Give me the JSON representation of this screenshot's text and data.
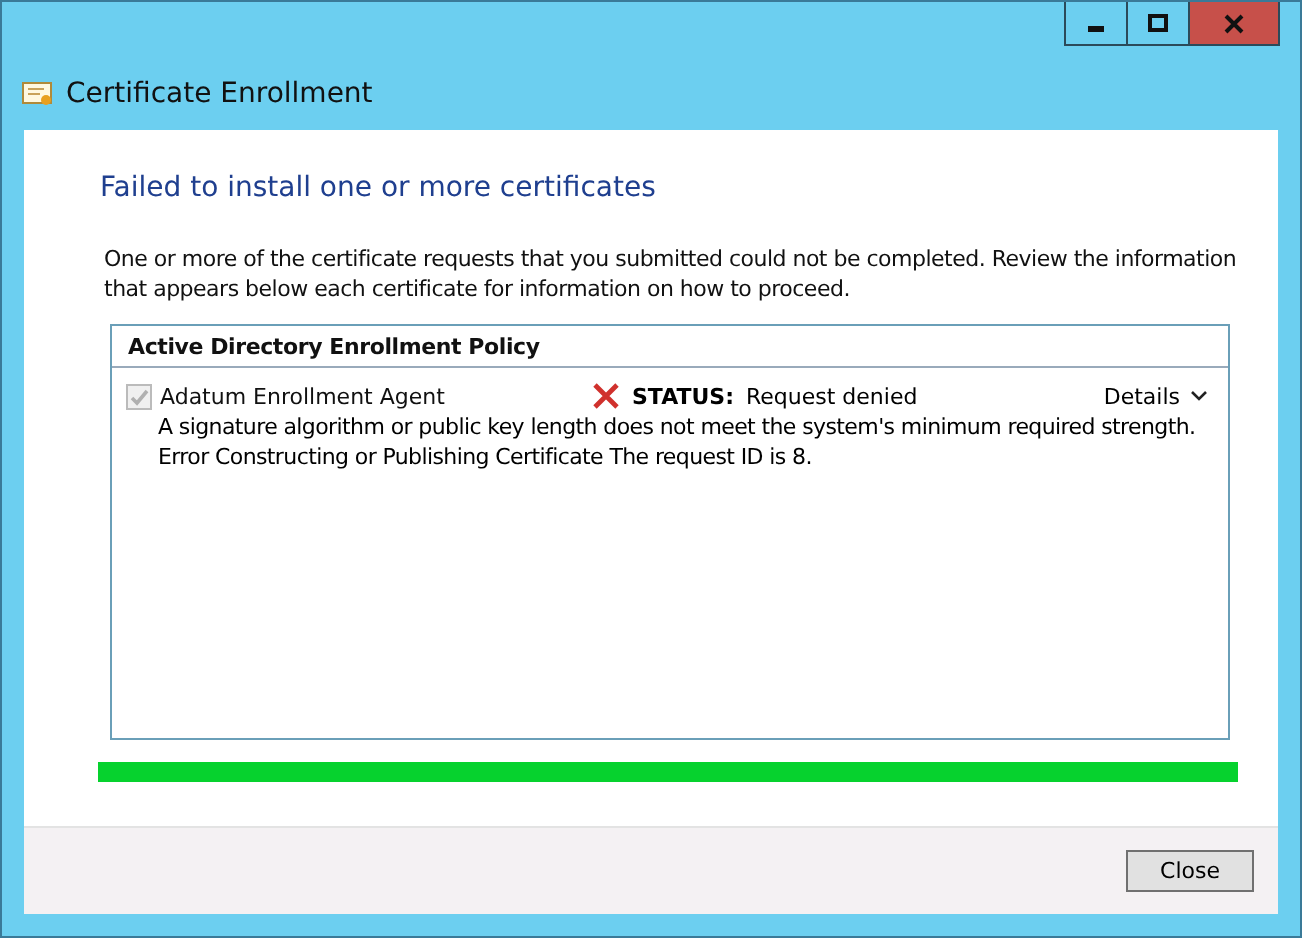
{
  "window": {
    "title": "Certificate Enrollment"
  },
  "heading": "Failed to install one or more certificates",
  "intro": "One or more of the certificate requests that you submitted could not be completed. Review the information that appears below each certificate for information on how to proceed.",
  "policy": {
    "title": "Active Directory Enrollment Policy",
    "items": [
      {
        "name": "Adatum Enrollment Agent",
        "checked": true,
        "disabled": true,
        "status_label": "STATUS:",
        "status": "Request denied",
        "details": "Details",
        "message": "A signature algorithm or public key length does not meet the system's minimum required strength. Error Constructing or Publishing Certificate The request ID is 8."
      }
    ]
  },
  "progress": {
    "level": 1
  },
  "buttons": [
    "Close"
  ]
}
